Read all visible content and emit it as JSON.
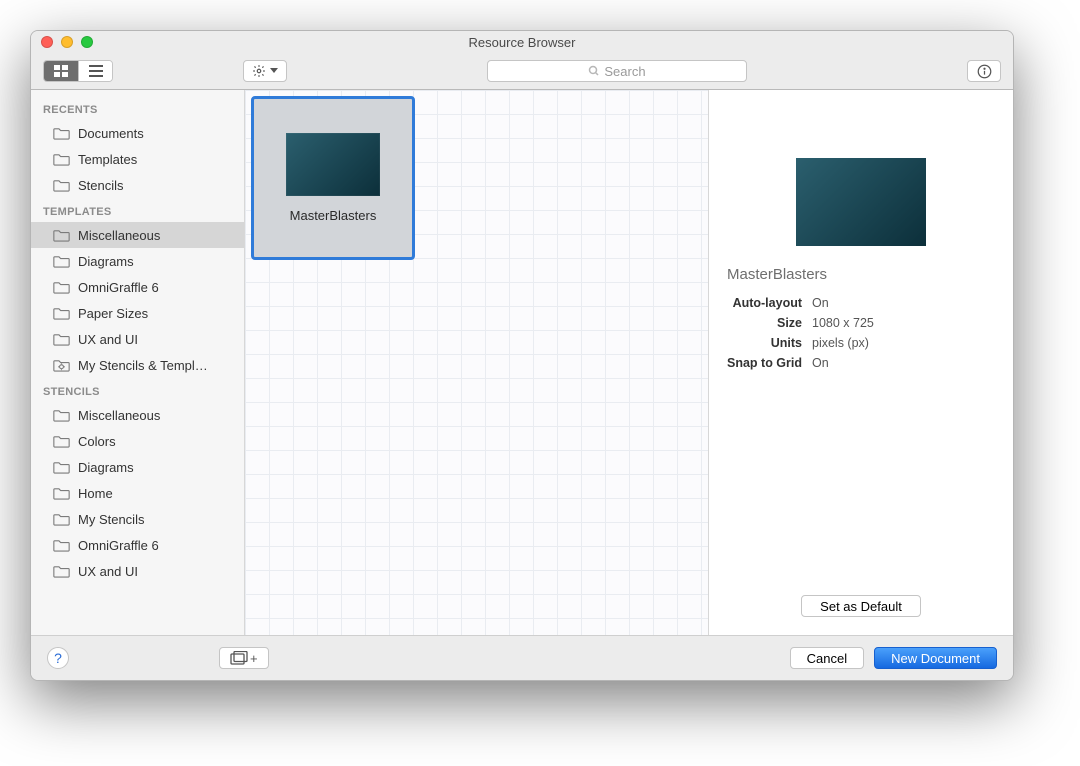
{
  "window": {
    "title": "Resource Browser"
  },
  "toolbar": {
    "search_placeholder": "Search"
  },
  "sidebar": {
    "sections": [
      {
        "title": "RECENTS",
        "items": [
          {
            "label": "Documents"
          },
          {
            "label": "Templates"
          },
          {
            "label": "Stencils"
          }
        ]
      },
      {
        "title": "TEMPLATES",
        "items": [
          {
            "label": "Miscellaneous",
            "selected": true
          },
          {
            "label": "Diagrams"
          },
          {
            "label": "OmniGraffle 6"
          },
          {
            "label": "Paper Sizes"
          },
          {
            "label": "UX and UI"
          },
          {
            "label": "My Stencils & Templ…",
            "special": true
          }
        ]
      },
      {
        "title": "STENCILS",
        "items": [
          {
            "label": "Miscellaneous"
          },
          {
            "label": "Colors"
          },
          {
            "label": "Diagrams"
          },
          {
            "label": "Home"
          },
          {
            "label": "My Stencils"
          },
          {
            "label": "OmniGraffle 6"
          },
          {
            "label": "UX and UI"
          }
        ]
      }
    ]
  },
  "grid": {
    "items": [
      {
        "label": "MasterBlasters",
        "selected": true
      }
    ]
  },
  "detail": {
    "name": "MasterBlasters",
    "meta": [
      {
        "k": "Auto-layout",
        "v": "On"
      },
      {
        "k": "Size",
        "v": "1080 x 725"
      },
      {
        "k": "Units",
        "v": "pixels (px)"
      },
      {
        "k": "Snap to Grid",
        "v": "On"
      }
    ],
    "default_btn": "Set as Default"
  },
  "footer": {
    "cancel": "Cancel",
    "primary": "New Document"
  }
}
